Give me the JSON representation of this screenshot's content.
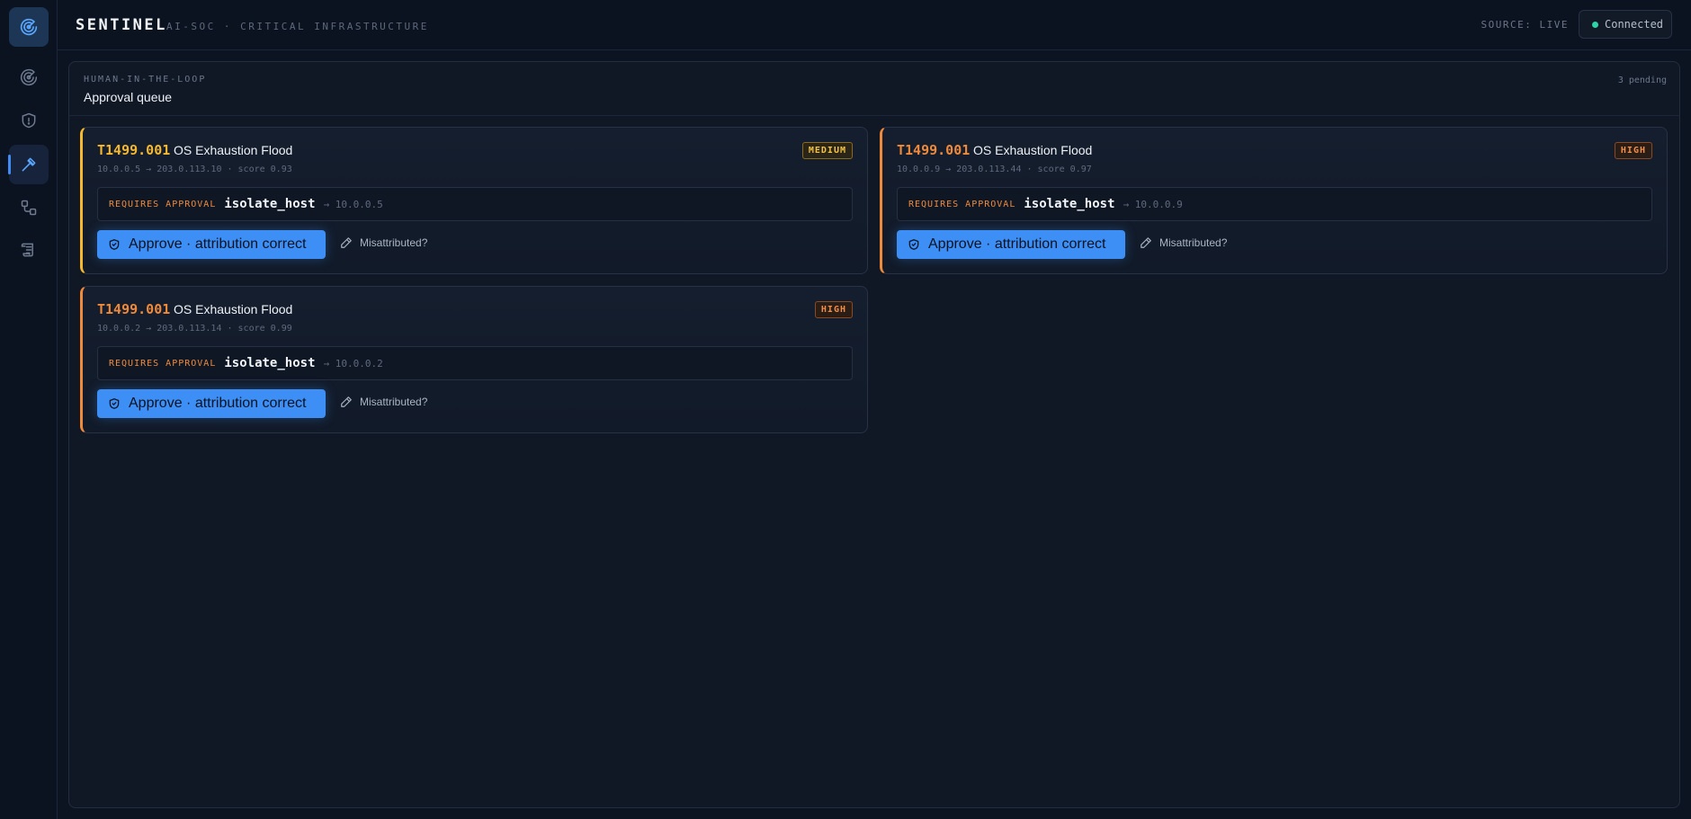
{
  "header": {
    "brand": "SENTINEL",
    "subtitle": "AI-SOC · CRITICAL INFRASTRUCTURE",
    "source": "SOURCE: LIVE",
    "connection": "Connected"
  },
  "sidebar": {
    "items": [
      {
        "icon": "logo-radar-icon"
      },
      {
        "icon": "radar-icon"
      },
      {
        "icon": "shield-icon"
      },
      {
        "icon": "hammer-icon",
        "active": true
      },
      {
        "icon": "workflow-icon"
      },
      {
        "icon": "scroll-icon"
      }
    ]
  },
  "panel": {
    "eyebrow": "HUMAN-IN-THE-LOOP",
    "title": "Approval queue",
    "pending": "3 pending"
  },
  "cards": [
    {
      "technique": "T1499.001",
      "name": "OS Exhaustion Flood",
      "meta": "10.0.0.5 → 203.0.113.10 · score 0.93",
      "severity": "MEDIUM",
      "requires": "REQUIRES APPROVAL",
      "action": "isolate_host",
      "target": "→ 10.0.0.5",
      "approve_label": "Approve · attribution correct",
      "misattributed_label": "Misattributed?"
    },
    {
      "technique": "T1499.001",
      "name": "OS Exhaustion Flood",
      "meta": "10.0.0.9 → 203.0.113.44 · score 0.97",
      "severity": "HIGH",
      "requires": "REQUIRES APPROVAL",
      "action": "isolate_host",
      "target": "→ 10.0.0.9",
      "approve_label": "Approve · attribution correct",
      "misattributed_label": "Misattributed?"
    },
    {
      "technique": "T1499.001",
      "name": "OS Exhaustion Flood",
      "meta": "10.0.0.2 → 203.0.113.14 · score 0.99",
      "severity": "HIGH",
      "requires": "REQUIRES APPROVAL",
      "action": "isolate_host",
      "target": "→ 10.0.0.2",
      "approve_label": "Approve · attribution correct",
      "misattributed_label": "Misattributed?"
    }
  ],
  "colors": {
    "accent": "#3d8ef5",
    "medium": "#f5b82e",
    "high": "#f08a3b",
    "connected": "#2dd4a8"
  }
}
